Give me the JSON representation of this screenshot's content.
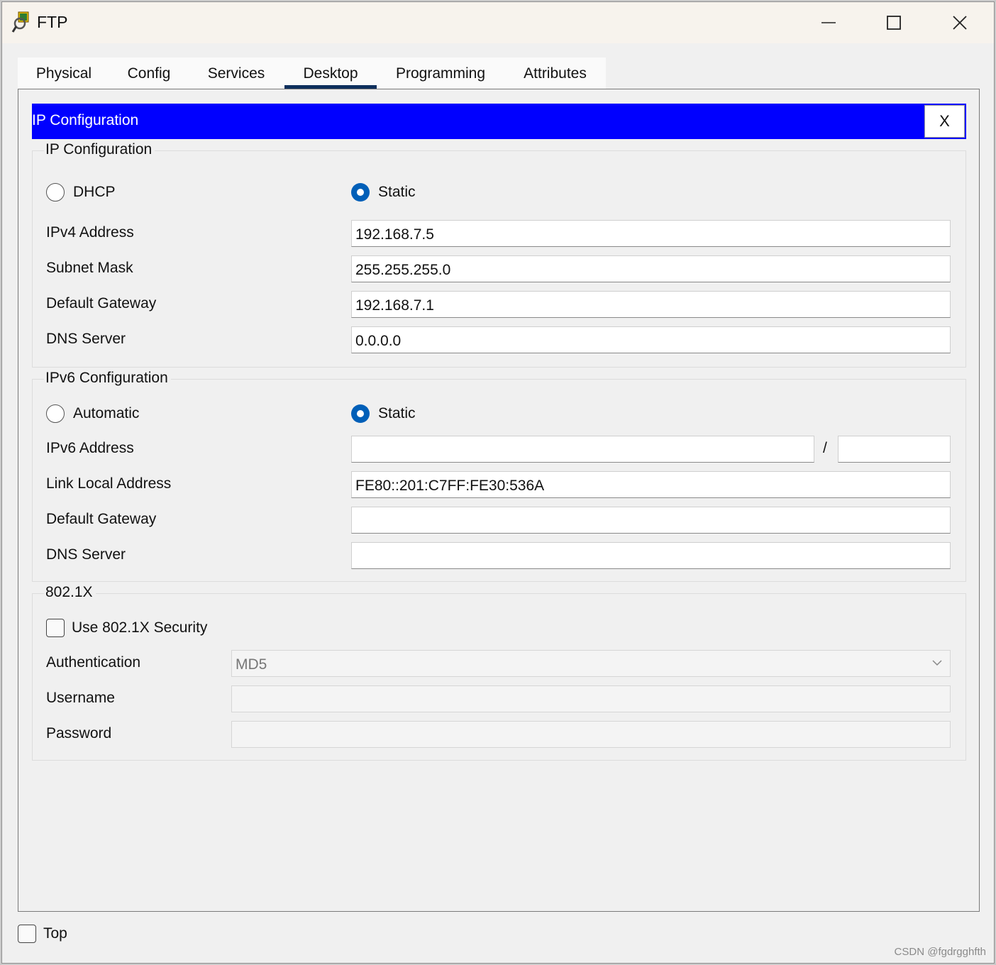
{
  "window": {
    "title": "FTP"
  },
  "tabs": [
    "Physical",
    "Config",
    "Services",
    "Desktop",
    "Programming",
    "Attributes"
  ],
  "active_tab": "Desktop",
  "panel": {
    "title": "IP Configuration",
    "close_label": "X"
  },
  "ipv4": {
    "legend": "IP Configuration",
    "dhcp_label": "DHCP",
    "static_label": "Static",
    "selected_mode": "Static",
    "fields": [
      {
        "label": "IPv4 Address",
        "value": "192.168.7.5"
      },
      {
        "label": "Subnet Mask",
        "value": "255.255.255.0"
      },
      {
        "label": "Default Gateway",
        "value": "192.168.7.1"
      },
      {
        "label": "DNS Server",
        "value": "0.0.0.0"
      }
    ]
  },
  "ipv6": {
    "legend": "IPv6 Configuration",
    "automatic_label": "Automatic",
    "static_label": "Static",
    "selected_mode": "Static",
    "address_label": "IPv6 Address",
    "address_value": "",
    "prefix_separator": "/",
    "prefix_value": "",
    "link_local_label": "Link Local Address",
    "link_local_value": "FE80::201:C7FF:FE30:536A",
    "gateway_label": "Default Gateway",
    "gateway_value": "",
    "dns_label": "DNS Server",
    "dns_value": ""
  },
  "dot1x": {
    "legend": "802.1X",
    "use_security_label": "Use 802.1X Security",
    "use_security_checked": false,
    "auth_label": "Authentication",
    "auth_value": "MD5",
    "username_label": "Username",
    "username_value": "",
    "password_label": "Password",
    "password_value": ""
  },
  "footer": {
    "top_label": "Top",
    "top_checked": false
  },
  "watermark": "CSDN @fgdrgghfth",
  "colors": {
    "header_blue": "#0000ff",
    "radio_selected": "#005fb8",
    "active_tab_underline": "#0d2f5c"
  }
}
